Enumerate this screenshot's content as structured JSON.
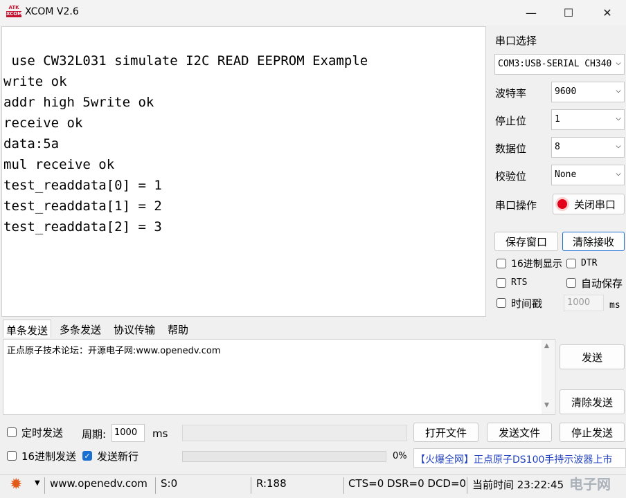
{
  "window": {
    "logo_top": "ATK",
    "logo_bottom": "XCOM",
    "title": "XCOM V2.6",
    "minimize_glyph": "—",
    "maximize_glyph": "☐",
    "close_glyph": "✕"
  },
  "receive": {
    "lines": [
      " use CW32L031 simulate I2C READ EEPROM Example",
      "write ok",
      "addr high 5write ok",
      "receive ok",
      "data:5a",
      "mul receive ok",
      "test_readdata[0] = 1",
      "test_readdata[1] = 2",
      "test_readdata[2] = 3"
    ]
  },
  "settings": {
    "port_select_label": "串口选择",
    "port_value": "COM3:USB-SERIAL CH340",
    "baud_label": "波特率",
    "baud_value": "9600",
    "stopbit_label": "停止位",
    "stopbit_value": "1",
    "databit_label": "数据位",
    "databit_value": "8",
    "parity_label": "校验位",
    "parity_value": "None",
    "port_op_label": "串口操作",
    "port_op_button": "关闭串口",
    "save_window": "保存窗口",
    "clear_receive": "清除接收",
    "hex_display": "16进制显示",
    "dtr": "DTR",
    "rts": "RTS",
    "auto_save": "自动保存",
    "timestamp": "时间戳",
    "timestamp_value": "1000",
    "timestamp_unit": "ms"
  },
  "tabs": [
    "单条发送",
    "多条发送",
    "协议传输",
    "帮助"
  ],
  "send": {
    "text": "正点原子技术论坛：开源电子网:www.openedv.com",
    "send_button": "发送",
    "clear_send_button": "清除发送",
    "timed_send": "定时发送",
    "period_label": "周期:",
    "period_value": "1000",
    "period_unit": "ms",
    "open_file": "打开文件",
    "send_file": "发送文件",
    "stop_send": "停止发送",
    "hex_send": "16进制发送",
    "send_newline": "发送新行",
    "progress_pct": "0%",
    "progress_value": 0,
    "ad_text": "【火爆全网】正点原子DS100手持示波器上市"
  },
  "status": {
    "url": "www.openedv.com",
    "sent": "S:0",
    "received": "R:188",
    "signals": "CTS=0 DSR=0 DCD=0",
    "time": "当前时间 23:22:45",
    "watermark": "电子网"
  },
  "colors": {
    "accent": "#1a6fd0",
    "ad_blue": "#1f3fbf",
    "led_red": "#e4001b",
    "gear": "#e25b1b"
  }
}
